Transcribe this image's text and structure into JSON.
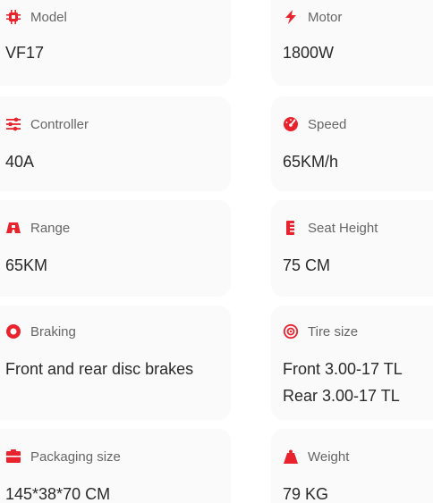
{
  "accent_color": "#e8232d",
  "specs": [
    {
      "key": "model",
      "icon": "chip-icon",
      "label": "Model",
      "value": "VF17"
    },
    {
      "key": "motor",
      "icon": "lightning-icon",
      "label": "Motor",
      "value": "1800W"
    },
    {
      "key": "controller",
      "icon": "sliders-icon",
      "label": "Controller",
      "value": "40A"
    },
    {
      "key": "speed",
      "icon": "speedometer-icon",
      "label": "Speed",
      "value": "65KM/h"
    },
    {
      "key": "range",
      "icon": "car-icon",
      "label": "Range",
      "value": "65KM"
    },
    {
      "key": "seat_height",
      "icon": "seat-icon",
      "label": "Seat Height",
      "value": "75 CM"
    },
    {
      "key": "braking",
      "icon": "brake-icon",
      "label": "Braking",
      "value": "Front and rear disc brakes"
    },
    {
      "key": "tire_size",
      "icon": "target-icon",
      "label": "Tire size",
      "value_lines": [
        "Front 3.00-17 TL",
        "Rear 3.00-17 TL"
      ]
    },
    {
      "key": "packaging_size",
      "icon": "box-icon",
      "label": "Packaging size",
      "value": "145*38*70 CM"
    },
    {
      "key": "weight",
      "icon": "weight-icon",
      "label": "Weight",
      "value": "79 KG"
    }
  ]
}
